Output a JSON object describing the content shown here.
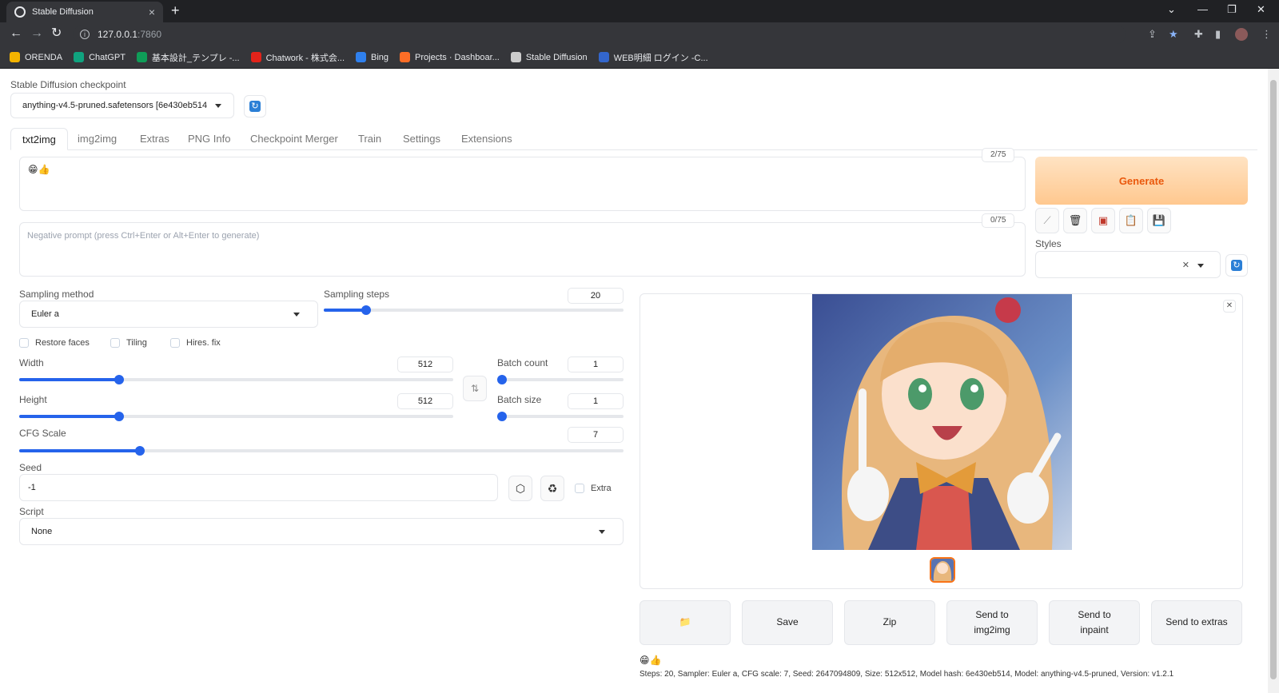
{
  "browser": {
    "tab_title": "Stable Diffusion",
    "url_host": "127.0.0.1",
    "url_port": ":7860",
    "bookmarks": [
      {
        "label": "ORENDA",
        "color": "#f4b400"
      },
      {
        "label": "ChatGPT",
        "color": "#10a37f"
      },
      {
        "label": "基本設計_テンプレ -...",
        "color": "#0f9d58"
      },
      {
        "label": "Chatwork - 株式会...",
        "color": "#e2231a"
      },
      {
        "label": "Bing",
        "color": "#2f80ed"
      },
      {
        "label": "Projects · Dashboar...",
        "color": "#fc6d26"
      },
      {
        "label": "Stable Diffusion",
        "color": "#cccccc"
      },
      {
        "label": "WEB明細 ログイン -C...",
        "color": "#3366cc"
      }
    ]
  },
  "checkpoint": {
    "label": "Stable Diffusion checkpoint",
    "value": "anything-v4.5-pruned.safetensors [6e430eb514"
  },
  "tabs": [
    "txt2img",
    "img2img",
    "Extras",
    "PNG Info",
    "Checkpoint Merger",
    "Train",
    "Settings",
    "Extensions"
  ],
  "prompt": {
    "value": "😁👍",
    "counter": "2/75"
  },
  "negative_prompt": {
    "placeholder": "Negative prompt (press Ctrl+Enter or Alt+Enter to generate)",
    "counter": "0/75"
  },
  "generate_label": "Generate",
  "styles_label": "Styles",
  "sampling": {
    "method_label": "Sampling method",
    "method_value": "Euler a",
    "steps_label": "Sampling steps",
    "steps_value": "20",
    "steps_fraction": 0.14
  },
  "checkboxes": {
    "restore_faces": "Restore faces",
    "tiling": "Tiling",
    "hires_fix": "Hires. fix",
    "extra": "Extra"
  },
  "width": {
    "label": "Width",
    "value": "512",
    "fraction": 0.23
  },
  "height": {
    "label": "Height",
    "value": "512",
    "fraction": 0.23
  },
  "batch_count": {
    "label": "Batch count",
    "value": "1",
    "fraction": 0.0
  },
  "batch_size": {
    "label": "Batch size",
    "value": "1",
    "fraction": 0.0
  },
  "cfg": {
    "label": "CFG Scale",
    "value": "7",
    "fraction": 0.2
  },
  "seed": {
    "label": "Seed",
    "value": "-1"
  },
  "script": {
    "label": "Script",
    "value": "None"
  },
  "output_buttons": {
    "save": "Save",
    "zip": "Zip",
    "send_img2img": "Send to img2img",
    "send_inpaint": "Send to inpaint",
    "send_extras": "Send to extras"
  },
  "output_prompt": "😁👍",
  "output_info": "Steps: 20, Sampler: Euler a, CFG scale: 7, Seed: 2647094809, Size: 512x512, Model hash: 6e430eb514, Model: anything-v4.5-pruned, Version: v1.2.1",
  "colors": {
    "accent": "#2563eb",
    "generate": "#ea580c"
  }
}
